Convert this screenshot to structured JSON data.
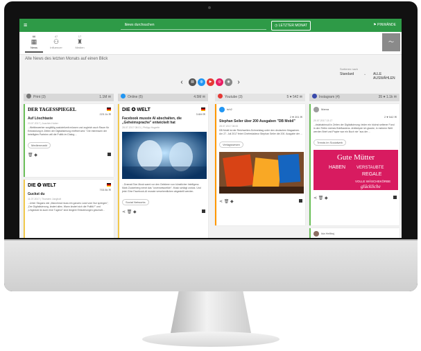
{
  "topbar": {
    "menu_glyph": "≡",
    "search_placeholder": "News durchsuchen",
    "time_filter": "LETZTER MONAT",
    "pinwall": "PINWÄNDE"
  },
  "tabs": [
    {
      "label": "News",
      "count": "66"
    },
    {
      "label": "Influencer",
      "count": "47"
    },
    {
      "label": "Medien",
      "count": "17"
    }
  ],
  "page": {
    "heading": "Alle News des letzten Monats auf einen Blick",
    "sort_label": "Sortieren nach",
    "sort_value": "Standard",
    "select_all": "ALLE AUSWÄHLEN"
  },
  "carousel": {
    "prev": "‹",
    "next": "›",
    "dots": [
      "#555555",
      "#2196f3",
      "#e53935",
      "#e91e63",
      "#888888"
    ]
  },
  "columns": [
    {
      "name": "Print (3)",
      "stats": "1.1M  ✉",
      "color": "#777777"
    },
    {
      "name": "Online (5)",
      "stats": "4.5M  ✉",
      "color": "#2196f3"
    },
    {
      "name": "Youtube (3)",
      "stats": "5 ♥ 542 ✉",
      "color": "#e53935"
    },
    {
      "name": "Instagram (4)",
      "stats": "35 ♥ 1.1k ✉",
      "color": "#3949ab"
    }
  ],
  "cards": {
    "print1": {
      "source": "DER TAGESSPIEGEL",
      "metric": "223.1k ✉",
      "title": "Auf Löschtaste",
      "date": "23.07.2017 | Joachim Huber",
      "text": "...Wettbewerber sorgfältig auslotet/zeit müssen und zugleich auch Raum für Entwicklung in Zeiten der Digitalisierung eröffnet wird.\" Die Interessen der beteiligten Parteien will die Politik im Dialog ...",
      "tag": "Medienmarkt"
    },
    "print2": {
      "source": "DIE ✪ WELT",
      "metric": "703.5k ✉",
      "title": "Guckst du",
      "date": "11.07.2017 | Thorsten Jungholt",
      "text": "...Unter Slogans wie „Manchmal muss ein ganzes Land vom Nur springen\", „Der Digitalisierung, ändert alles. Wann ändert sich die Politik?\" und „Ungeduld ist auch eine Tugend\" sind längere Erläuterungen geschalt..."
    },
    "online1": {
      "source": "DIE ✪ WELT",
      "metric": "3.6M ✉",
      "title": "Facebook musste AI abschalten, die „Geheimsprache\" entwickelt hat",
      "date": "28.07.2017 08:01 | Philipp Hogrefe",
      "text": "...Dramat Elon Musk warnt vor den Gefahren von künstlicher Intelligenz. Mark Zuckerberg nennt das \"unverantwortlich\". Musk schlägt zurück. Und jetzt: Eine Facebook-AI musste versehentlichen abgestellt werden.",
      "tag": "Social Networks"
    },
    "yt1": {
      "source": "tuh2",
      "metric": "2 ♥ 201 ✉",
      "title": "Stephan Seiler über 200 Ausgaben \"DB Mobil\"",
      "date": "28.07.2017 08:00",
      "text": "DB Mobil ist der Reichweiten-Schmelztag unter den deutschen Magazinen. Am 27. Juli 2017 feiert Chefredakteur Stephan Seiler die 200. Ausgabe der ...",
      "tag": "Verlagswesen"
    },
    "ig1": {
      "source": "Mama",
      "metric": "2 ♥ 542 ✉",
      "date": "20.07.2017 13:17",
      "text": "...#stahabinsoll in Zeiten der Digitalisierung: leider ein höchst seltener Fund in den Tiefen meines Briefkastens. #rettedyde ich glaube, in meinem Welt werden Brief und Papier war ein Buch nie \"aus der ...",
      "tag": "Trends im Socialweb",
      "poster": [
        "Gute Mütter",
        "HABEN",
        "VERSTAUBTE",
        "REGALE",
        "VOLLE WÄSCHEKÖRBE",
        "glückliche"
      ]
    },
    "ig2": {
      "source": "Ida Hellboj"
    }
  }
}
